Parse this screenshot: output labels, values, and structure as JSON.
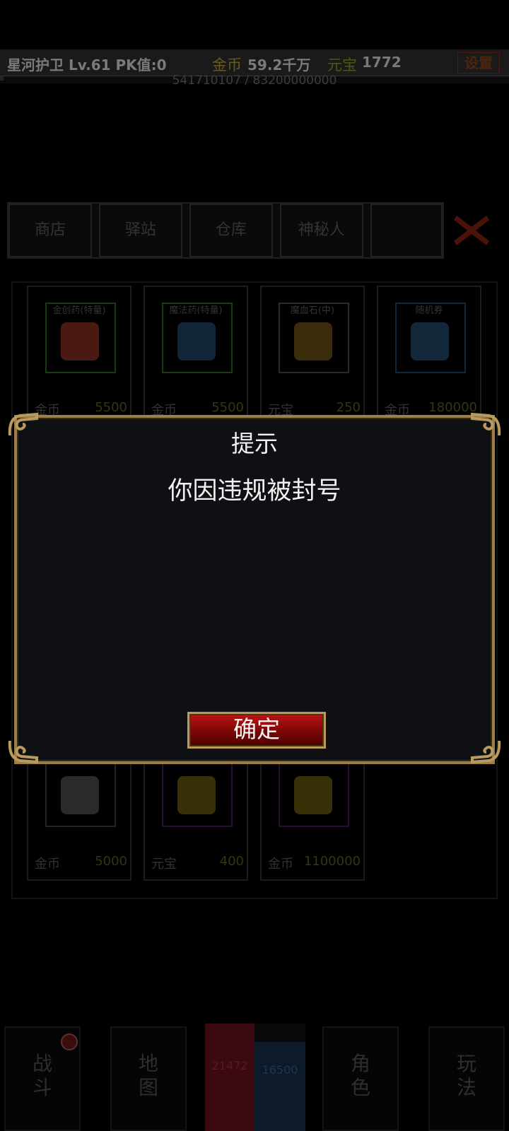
{
  "topbar": {
    "player": "星河护卫 Lv.61 PK值:0",
    "gold_label": "金币",
    "gold_value": "59.2千万",
    "ingot_label": "元宝",
    "ingot_value": "1772",
    "settings": "设置",
    "exp_text": "541710107 / 83200000000",
    "exp_fraction": 0.0065
  },
  "tabs": [
    "商店",
    "驿站",
    "仓库",
    "神秘人",
    ""
  ],
  "items": [
    {
      "name": "金创药(特量)",
      "currency": "金币",
      "price": "5500",
      "border": "#1a3a12",
      "icon": "#4a1a12"
    },
    {
      "name": "魔法药(特量)",
      "currency": "金币",
      "price": "5500",
      "border": "#1a3a12",
      "icon": "#12263a"
    },
    {
      "name": "魔血石(中)",
      "currency": "元宝",
      "price": "250",
      "border": "#2a2a2a",
      "icon": "#3a2c0a"
    },
    {
      "name": "随机券",
      "currency": "金币",
      "price": "180000",
      "border": "#0e2a3a",
      "icon": "#12283a"
    },
    {
      "name": "",
      "currency": "",
      "price": "",
      "border": "#161616",
      "icon": "#0c0c0c"
    },
    {
      "name": "",
      "currency": "",
      "price": "",
      "border": "#161616",
      "icon": "#0c0c0c"
    },
    {
      "name": "",
      "currency": "",
      "price": "",
      "border": "#161616",
      "icon": "#0c0c0c"
    },
    {
      "name": "",
      "currency": "",
      "price": "",
      "border": "#161616",
      "icon": "#0c0c0c"
    },
    {
      "name": "",
      "currency": "",
      "price": "",
      "border": "#161616",
      "icon": "#0c0c0c"
    },
    {
      "name": "",
      "currency": "",
      "price": "",
      "border": "#161616",
      "icon": "#0c0c0c"
    },
    {
      "name": "",
      "currency": "",
      "price": "",
      "border": "#161616",
      "icon": "#0c0c0c"
    },
    {
      "name": "",
      "currency": "",
      "price": "",
      "border": "#161616",
      "icon": "#0c0c0c"
    },
    {
      "name": "",
      "currency": "金币",
      "price": "5000",
      "border": "#242424",
      "icon": "#2a2a2a"
    },
    {
      "name": "",
      "currency": "元宝",
      "price": "400",
      "border": "#2a1030",
      "icon": "#3a3008"
    },
    {
      "name": "",
      "currency": "金币",
      "price": "1100000",
      "border": "#2a1030",
      "icon": "#3a3008"
    }
  ],
  "bottom_nav": {
    "battle": "战斗",
    "map": "地图",
    "hp": "21472",
    "mp": "16500",
    "role": "角色",
    "play": "玩法"
  },
  "dialog": {
    "title": "提示",
    "message": "你因违规被封号",
    "confirm": "确定"
  },
  "colors": {
    "dialog_border": "#9c7f48",
    "confirm_red": "#c01414"
  }
}
